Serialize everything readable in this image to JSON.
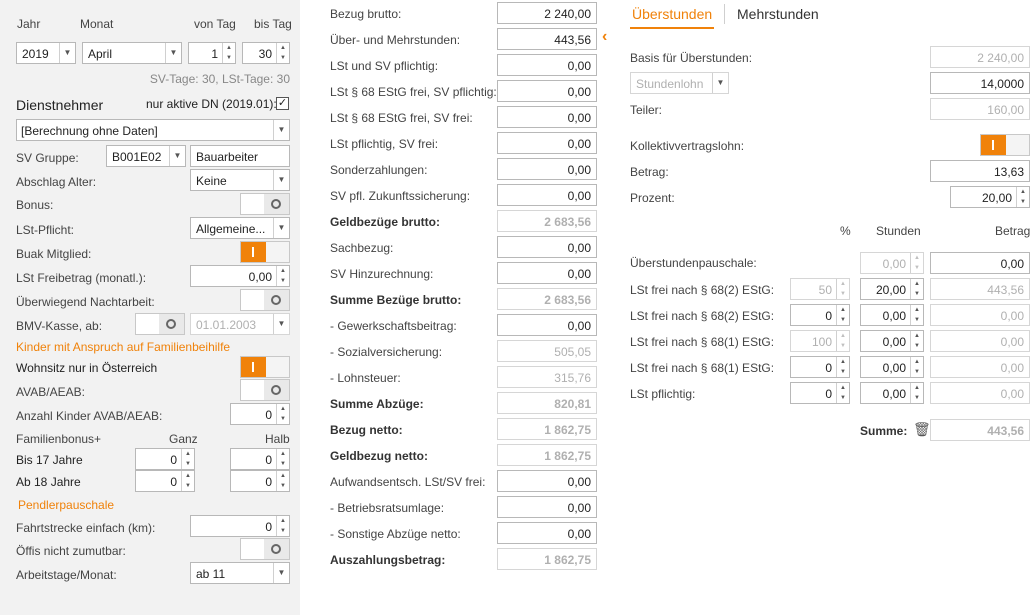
{
  "left": {
    "jahr_label": "Jahr",
    "monat_label": "Monat",
    "von_tag_label": "von Tag",
    "bis_tag_label": "bis Tag",
    "jahr": "2019",
    "monat": "April",
    "von_tag": "1",
    "bis_tag": "30",
    "tage_info": "SV-Tage: 30, LSt-Tage: 30",
    "dienstnehmer_heading": "Dienstnehmer",
    "nur_aktive_label": "nur aktive DN (2019.01):",
    "nur_aktive_checked": "✓",
    "dn_select": "[Berechnung ohne Daten]",
    "sv_gruppe_label": "SV Gruppe:",
    "sv_gruppe_code": "B001E02",
    "sv_gruppe_text": "Bauarbeiter",
    "abschlag_alter_label": "Abschlag Alter:",
    "abschlag_alter": "Keine",
    "bonus_label": "Bonus:",
    "lst_pflicht_label": "LSt-Pflicht:",
    "lst_pflicht": "Allgemeine...",
    "buak_label": "Buak Mitglied:",
    "lst_freibetrag_label": "LSt Freibetrag (monatl.):",
    "lst_freibetrag": "0,00",
    "nachtarbeit_label": "Überwiegend Nachtarbeit:",
    "bmv_label": "BMV-Kasse, ab:",
    "bmv_date": "01.01.2003",
    "kinder_heading": "Kinder mit Anspruch auf Familienbeihilfe",
    "wohnsitz_label": "Wohnsitz nur in Österreich",
    "avab_label": "AVAB/AEAB:",
    "anzahl_kinder_label": "Anzahl Kinder AVAB/AEAB:",
    "anzahl_kinder": "0",
    "familienbonus_label": "Familienbonus+",
    "ganz_label": "Ganz",
    "halb_label": "Halb",
    "bis17_label": "Bis 17 Jahre",
    "bis17_ganz": "0",
    "bis17_halb": "0",
    "ab18_label": "Ab 18 Jahre",
    "ab18_ganz": "0",
    "ab18_halb": "0",
    "pendler_heading": "Pendlerpauschale",
    "fahrtstrecke_label": "Fahrtstrecke einfach (km):",
    "fahrtstrecke": "0",
    "oeffis_label": "Öffis nicht zumutbar:",
    "arbeitstage_label": "Arbeitstage/Monat:",
    "arbeitstage": "ab 11"
  },
  "middle": {
    "rows": [
      {
        "label": "Bezug brutto:",
        "value": "2 240,00",
        "bold": false,
        "disabled": false
      },
      {
        "label": "Über- und Mehrstunden:",
        "value": "443,56",
        "bold": false,
        "disabled": false
      },
      {
        "label": "LSt und SV pflichtig:",
        "value": "0,00",
        "bold": false,
        "disabled": false
      },
      {
        "label": "LSt § 68 EStG frei, SV pflichtig:",
        "value": "0,00",
        "bold": false,
        "disabled": false
      },
      {
        "label": "LSt § 68 EStG frei, SV frei:",
        "value": "0,00",
        "bold": false,
        "disabled": false
      },
      {
        "label": "LSt pflichtig, SV frei:",
        "value": "0,00",
        "bold": false,
        "disabled": false
      },
      {
        "label": "Sonderzahlungen:",
        "value": "0,00",
        "bold": false,
        "disabled": false
      },
      {
        "label": "SV pfl. Zukunftssicherung:",
        "value": "0,00",
        "bold": false,
        "disabled": false
      },
      {
        "label": "Geldbezüge brutto:",
        "value": "2 683,56",
        "bold": true,
        "disabled": true
      },
      {
        "label": "Sachbezug:",
        "value": "0,00",
        "bold": false,
        "disabled": false
      },
      {
        "label": "SV Hinzurechnung:",
        "value": "0,00",
        "bold": false,
        "disabled": false
      },
      {
        "label": "Summe Bezüge brutto:",
        "value": "2 683,56",
        "bold": true,
        "disabled": true
      },
      {
        "label": "- Gewerkschaftsbeitrag:",
        "value": "0,00",
        "bold": false,
        "disabled": false
      },
      {
        "label": "- Sozialversicherung:",
        "value": "505,05",
        "bold": false,
        "disabled": true
      },
      {
        "label": "- Lohnsteuer:",
        "value": "315,76",
        "bold": false,
        "disabled": true
      },
      {
        "label": "Summe Abzüge:",
        "value": "820,81",
        "bold": true,
        "disabled": true
      },
      {
        "label": "Bezug netto:",
        "value": "1 862,75",
        "bold": true,
        "disabled": true
      },
      {
        "label": "Geldbezug netto:",
        "value": "1 862,75",
        "bold": true,
        "disabled": true
      },
      {
        "label": "Aufwandsentsch. LSt/SV frei:",
        "value": "0,00",
        "bold": false,
        "disabled": false
      },
      {
        "label": "- Betriebsratsumlage:",
        "value": "0,00",
        "bold": false,
        "disabled": false
      },
      {
        "label": "- Sonstige Abzüge netto:",
        "value": "0,00",
        "bold": false,
        "disabled": false
      },
      {
        "label": "Auszahlungsbetrag:",
        "value": "1 862,75",
        "bold": true,
        "disabled": true
      }
    ],
    "arrow": "‹"
  },
  "right": {
    "tab_ueberstunden": "Überstunden",
    "tab_mehrstunden": "Mehrstunden",
    "basis_label": "Basis für Überstunden:",
    "basis": "2 240,00",
    "stundenlohn_select": "Stundenlohn",
    "stundenlohn_value": "14,0000",
    "teiler_label": "Teiler:",
    "teiler": "160,00",
    "kv_label": "Kollektivvertragslohn:",
    "betrag_label": "Betrag:",
    "betrag": "13,63",
    "prozent_label": "Prozent:",
    "prozent": "20,00",
    "col_pct": "%",
    "col_stunden": "Stunden",
    "col_betrag": "Betrag",
    "pauschale_label": "Überstundenpauschale:",
    "pauschale_stunden": "0,00",
    "pauschale_betrag": "0,00",
    "table_rows": [
      {
        "label": "LSt frei nach § 68(2) EStG:",
        "pct": "50",
        "pct_disabled": true,
        "stunden": "20,00",
        "betrag": "443,56"
      },
      {
        "label": "LSt frei nach § 68(2) EStG:",
        "pct": "0",
        "pct_disabled": false,
        "stunden": "0,00",
        "betrag": "0,00"
      },
      {
        "label": "LSt frei nach § 68(1) EStG:",
        "pct": "100",
        "pct_disabled": true,
        "stunden": "0,00",
        "betrag": "0,00"
      },
      {
        "label": "LSt frei nach § 68(1) EStG:",
        "pct": "0",
        "pct_disabled": false,
        "stunden": "0,00",
        "betrag": "0,00"
      },
      {
        "label": "LSt pflichtig:",
        "pct": "0",
        "pct_disabled": false,
        "stunden": "0,00",
        "betrag": "0,00"
      }
    ],
    "summe_label": "Summe:",
    "summe": "443,56"
  },
  "colors": {
    "accent": "#f0820a",
    "panel": "#f2f2f2"
  }
}
